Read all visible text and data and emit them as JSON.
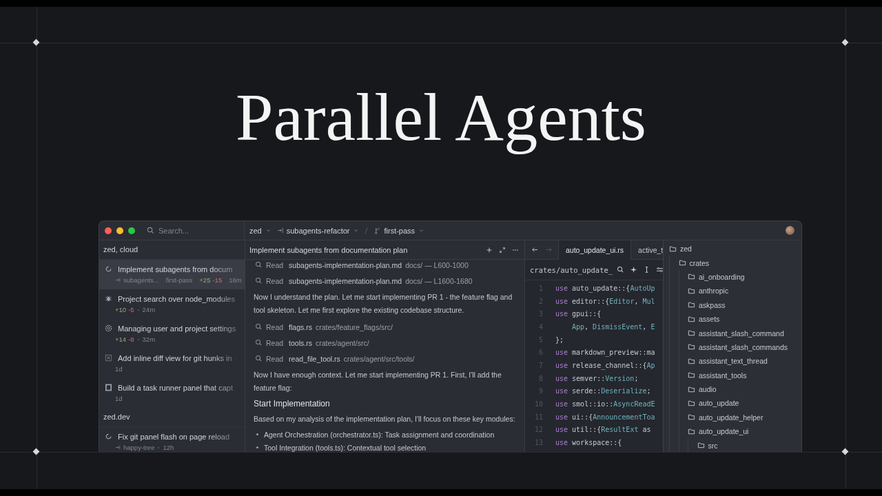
{
  "headline": "Parallel Agents",
  "window": {
    "search": {
      "placeholder": "Search..."
    },
    "project": "zed",
    "worktree": "subagents-refactor",
    "branch": "first-pass",
    "sidebar": {
      "groups": [
        {
          "name": "zed, cloud",
          "threads": [
            {
              "kind": "spinner",
              "title": "Implement subagents from docum",
              "selected": true,
              "worktree": "subagents...",
              "branch": "first-pass",
              "added": "+25",
              "removed": "-15",
              "time": "16m"
            },
            {
              "kind": "bug",
              "title": "Project search over node_modules",
              "selected": false,
              "added": "+10",
              "removed": "-5",
              "time": "24m"
            },
            {
              "kind": "gear",
              "title": "Managing user and project settings",
              "selected": false,
              "added": "+14",
              "removed": "-8",
              "time": "32m"
            },
            {
              "kind": "diff",
              "title": "Add inline diff view for git hunks in",
              "selected": false,
              "time": "1d"
            },
            {
              "kind": "square",
              "title": "Build a task runner panel that capt",
              "selected": false,
              "time": "1d"
            }
          ]
        },
        {
          "name": "zed.dev",
          "threads": [
            {
              "kind": "spinner",
              "title": "Fix git panel flash on page reload",
              "selected": false,
              "worktree": "happy-tree",
              "time": "12h"
            }
          ]
        }
      ]
    },
    "agent_panel": {
      "title": "Implement subagents from documentation plan",
      "items": [
        {
          "kind": "read",
          "label": "Read",
          "file": "subagents-implementation-plan.md",
          "detail": "docs/ — L600-1000"
        },
        {
          "kind": "read",
          "label": "Read",
          "file": "subagents-implementation-plan.md",
          "detail": "docs/ — L1600-1680"
        },
        {
          "kind": "paragraph",
          "text": "Now I understand the plan. Let me start implementing PR 1 - the feature flag and tool skeleton. Let me first explore the existing codebase structure."
        },
        {
          "kind": "read",
          "label": "Read",
          "file": "flags.rs",
          "detail": "crates/feature_flags/src/"
        },
        {
          "kind": "read",
          "label": "Read",
          "file": "tools.rs",
          "detail": "crates/agent/src/"
        },
        {
          "kind": "read",
          "label": "Read",
          "file": "read_file_tool.rs",
          "detail": "crates/agent/src/tools/"
        },
        {
          "kind": "paragraph",
          "text": "Now I have enough context. Let me start implementing PR 1. First, I'll add the feature flag:"
        },
        {
          "kind": "heading",
          "text": "Start Implementation"
        },
        {
          "kind": "paragraph",
          "text": "Based on my analysis of the implementation plan, I'll focus on these key modules:"
        },
        {
          "kind": "bullet",
          "text": "Agent Orchestration (orchestrator.ts): Task assignment and coordination"
        },
        {
          "kind": "bullet",
          "text": "Tool Integration (tools.ts): Contextual tool selection"
        }
      ]
    },
    "editor": {
      "tabs": [
        {
          "label": "auto_update_ui.rs",
          "selected": true
        },
        {
          "label": "active_t",
          "selected": false
        }
      ],
      "breadcrumb": "crates/auto_update_",
      "lines": [
        {
          "number": "1",
          "tokens": [
            {
              "kind": "keyword",
              "text": "use"
            },
            {
              "kind": "plain",
              "text": " auto_update::{"
            },
            {
              "kind": "type",
              "text": "AutoUp"
            }
          ]
        },
        {
          "number": "2",
          "tokens": [
            {
              "kind": "keyword",
              "text": "use"
            },
            {
              "kind": "plain",
              "text": " editor::{"
            },
            {
              "kind": "type",
              "text": "Editor"
            },
            {
              "kind": "plain",
              "text": ", "
            },
            {
              "kind": "type",
              "text": "Mul"
            }
          ]
        },
        {
          "number": "3",
          "tokens": [
            {
              "kind": "keyword",
              "text": "use"
            },
            {
              "kind": "plain",
              "text": " gpui::{"
            }
          ]
        },
        {
          "number": "4",
          "indented": true,
          "tokens": [
            {
              "kind": "type",
              "text": "App"
            },
            {
              "kind": "plain",
              "text": ", "
            },
            {
              "kind": "type",
              "text": "DismissEvent"
            },
            {
              "kind": "plain",
              "text": ", "
            },
            {
              "kind": "type",
              "text": "E"
            }
          ]
        },
        {
          "number": "5",
          "tokens": [
            {
              "kind": "plain",
              "text": "};"
            }
          ]
        },
        {
          "number": "6",
          "tokens": [
            {
              "kind": "keyword",
              "text": "use"
            },
            {
              "kind": "plain",
              "text": " markdown_preview::ma"
            }
          ]
        },
        {
          "number": "7",
          "tokens": [
            {
              "kind": "keyword",
              "text": "use"
            },
            {
              "kind": "plain",
              "text": " release_channel::{"
            },
            {
              "kind": "type",
              "text": "Ap"
            }
          ]
        },
        {
          "number": "8",
          "tokens": [
            {
              "kind": "keyword",
              "text": "use"
            },
            {
              "kind": "plain",
              "text": " semver::"
            },
            {
              "kind": "type",
              "text": "Version"
            },
            {
              "kind": "plain",
              "text": ";"
            }
          ]
        },
        {
          "number": "9",
          "tokens": [
            {
              "kind": "keyword",
              "text": "use"
            },
            {
              "kind": "plain",
              "text": " serde::"
            },
            {
              "kind": "type",
              "text": "Deserialize"
            },
            {
              "kind": "plain",
              "text": ";"
            }
          ]
        },
        {
          "number": "10",
          "tokens": [
            {
              "kind": "keyword",
              "text": "use"
            },
            {
              "kind": "plain",
              "text": " smol::io::"
            },
            {
              "kind": "type",
              "text": "AsyncReadE"
            }
          ]
        },
        {
          "number": "11",
          "tokens": [
            {
              "kind": "keyword",
              "text": "use"
            },
            {
              "kind": "plain",
              "text": " ui::{"
            },
            {
              "kind": "type",
              "text": "AnnouncementToa"
            }
          ]
        },
        {
          "number": "12",
          "tokens": [
            {
              "kind": "keyword",
              "text": "use"
            },
            {
              "kind": "plain",
              "text": " util::{"
            },
            {
              "kind": "type",
              "text": "ResultExt"
            },
            {
              "kind": "plain",
              "text": " as"
            }
          ]
        },
        {
          "number": "13",
          "tokens": [
            {
              "kind": "keyword",
              "text": "use"
            },
            {
              "kind": "plain",
              "text": " workspace::{"
            }
          ]
        }
      ]
    },
    "project_tree": {
      "items": [
        {
          "name": "zed",
          "children": [
            {
              "name": "crates",
              "children": [
                {
                  "name": "ai_onboarding"
                },
                {
                  "name": "anthropic"
                },
                {
                  "name": "askpass"
                },
                {
                  "name": "assets"
                },
                {
                  "name": "assistant_slash_command"
                },
                {
                  "name": "assistant_slash_commands"
                },
                {
                  "name": "assistant_text_thread"
                },
                {
                  "name": "assistant_tools"
                },
                {
                  "name": "audio"
                },
                {
                  "name": "auto_update"
                },
                {
                  "name": "auto_update_helper"
                },
                {
                  "name": "auto_update_ui",
                  "children": [
                    {
                      "name": "src"
                    }
                  ]
                }
              ]
            }
          ]
        }
      ]
    }
  }
}
